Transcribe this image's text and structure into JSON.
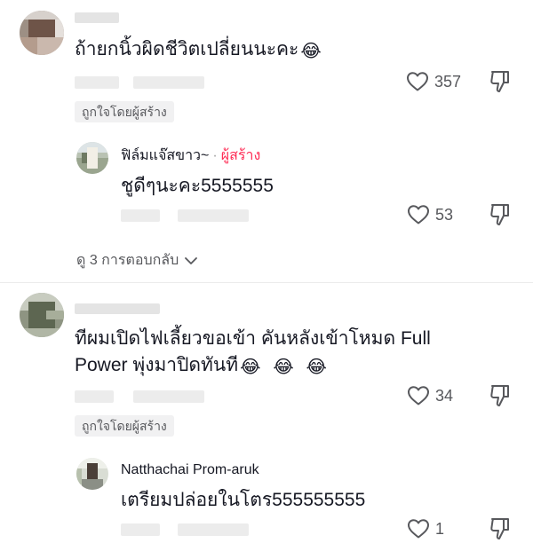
{
  "comments": [
    {
      "text": "ถ้ายกนิ้วผิดชีวิตเปลี่ยนนะคะ",
      "emojis": [
        "😂"
      ],
      "likes": "357",
      "creator_liked": "ถูกใจโดยผู้สร้าง",
      "reply": {
        "author": "ฟิล์มแจ๊สขาว~",
        "separator": "·",
        "creator_label": "ผู้สร้าง",
        "text": "ชูดีๆนะคะ5555555",
        "likes": "53"
      },
      "view_replies": "ดู 3 การตอบกลับ"
    },
    {
      "text_line1": "ทีผมเปิดไฟเลี้ยวขอเข้า คันหลังเข้าโหมด Full",
      "text_line2": "Power พุ่งมาปิดทันที",
      "emojis": [
        "😂",
        "😂",
        "😂"
      ],
      "likes": "34",
      "creator_liked": "ถูกใจโดยผู้สร้าง",
      "reply": {
        "author": "Natthachai Prom-aruk",
        "text": "เตรียมปล่อยในโตร555555555",
        "likes": "1"
      }
    }
  ],
  "icons": {
    "like": "heart-outline-icon",
    "dislike": "thumb-down-outline-icon",
    "expand": "chevron-down-icon"
  },
  "colors": {
    "text": "#161823",
    "muted": "#57585c",
    "creator": "#fe2c55",
    "chip_bg": "#f1f1f2"
  }
}
